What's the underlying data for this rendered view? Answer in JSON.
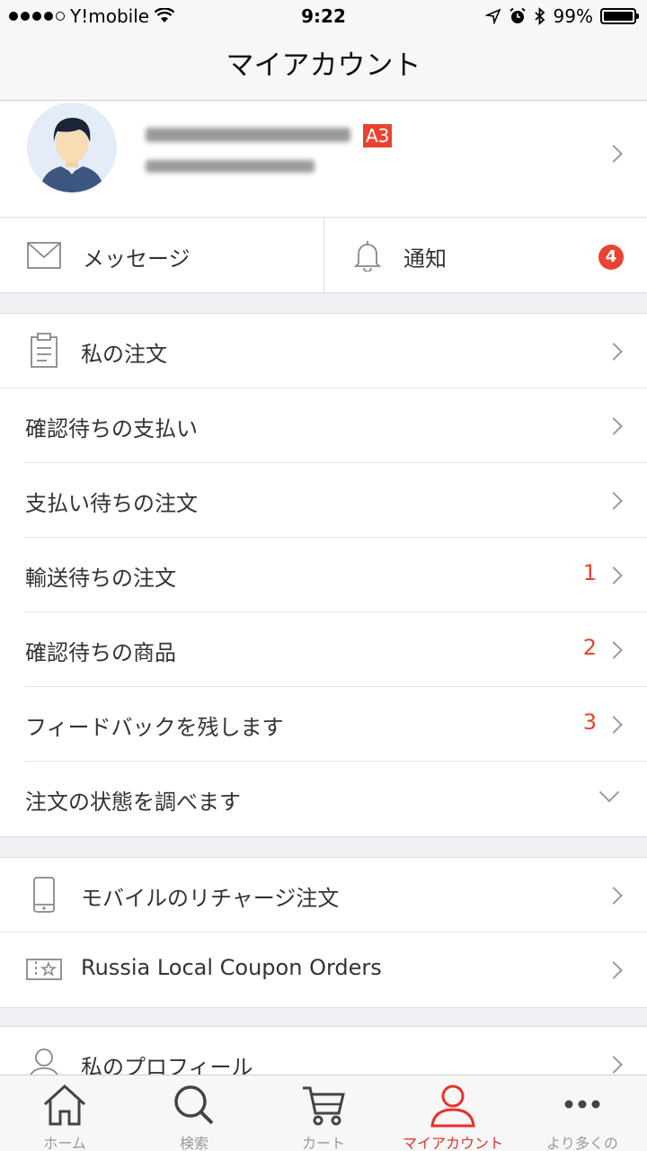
{
  "status_bar": {
    "carrier": "Y!mobile",
    "time": "9:22",
    "battery": "99%"
  },
  "header": {
    "title": "マイアカウント"
  },
  "profile": {
    "level_badge": "A3"
  },
  "quick_links": {
    "messages_label": "メッセージ",
    "notifications_label": "通知",
    "notifications_count": "4"
  },
  "orders": {
    "my_orders": "私の注文",
    "items": [
      {
        "label": "確認待ちの支払い",
        "count": ""
      },
      {
        "label": "支払い待ちの注文",
        "count": ""
      },
      {
        "label": "輸送待ちの注文",
        "count": "1"
      },
      {
        "label": "確認待ちの商品",
        "count": "2"
      },
      {
        "label": "フィードバックを残します",
        "count": "3"
      },
      {
        "label": "注文の状態を調べます",
        "count": ""
      }
    ]
  },
  "extra_orders": {
    "mobile_recharge": "モバイルのリチャージ注文",
    "coupon_orders": "Russia Local Coupon Orders"
  },
  "profile_section": {
    "my_profile": "私のプロフィール"
  },
  "tab_bar": {
    "home": "ホーム",
    "search": "検索",
    "cart": "カート",
    "account": "マイアカウント",
    "more": "より多くの"
  },
  "colors": {
    "accent": "#e9432f",
    "tab_active": "#e9312a"
  }
}
